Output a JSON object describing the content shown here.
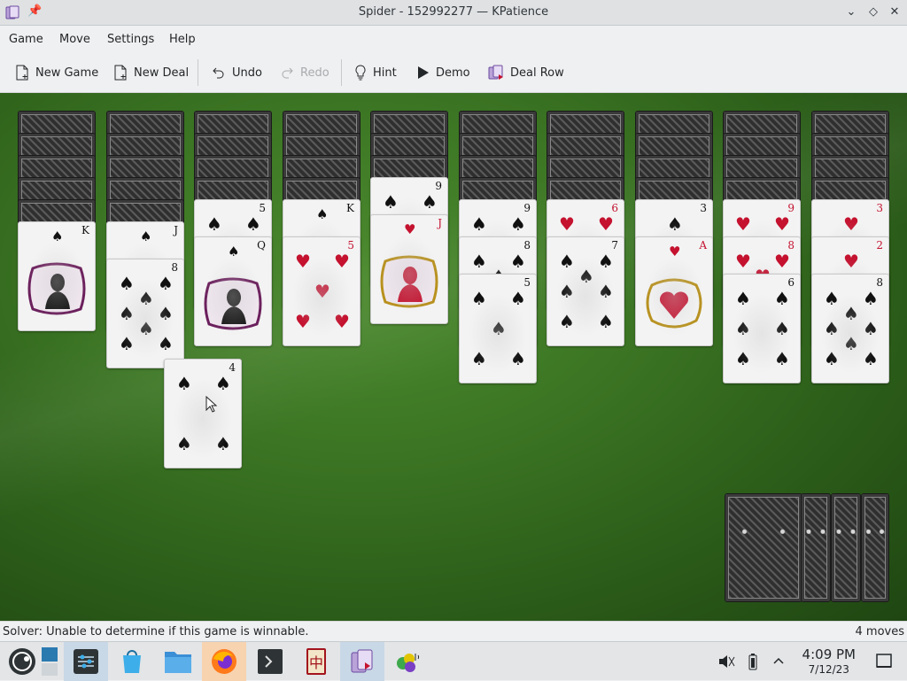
{
  "window": {
    "title": "Spider - 152992277 — KPatience",
    "pin_glyph": "📌",
    "min_glyph": "⌄",
    "max_glyph": "◇",
    "close_glyph": "✕"
  },
  "menu": [
    "Game",
    "Move",
    "Settings",
    "Help"
  ],
  "toolbar": {
    "new_game": "New Game",
    "new_deal": "New Deal",
    "undo": "Undo",
    "redo": "Redo",
    "hint": "Hint",
    "demo": "Demo",
    "deal_row": "Deal Row"
  },
  "colors": {
    "felt": "#3c7624",
    "red_suit": "#c4122f",
    "card_face": "#f3f3f3",
    "card_back": "#2f2f2f"
  },
  "tableau": {
    "columns": [
      {
        "hidden": 5,
        "cards": [
          {
            "rank": "K",
            "suit": "♠",
            "face": true
          }
        ]
      },
      {
        "hidden": 5,
        "cards": [
          {
            "rank": "J",
            "suit": "♠",
            "face": true
          },
          {
            "rank": "8",
            "suit": "♠"
          }
        ]
      },
      {
        "hidden": 4,
        "cards": [
          {
            "rank": "5",
            "suit": "♠"
          },
          {
            "rank": "Q",
            "suit": "♠",
            "face": true
          }
        ]
      },
      {
        "hidden": 4,
        "cards": [
          {
            "rank": "K",
            "suit": "♠",
            "face": true
          },
          {
            "rank": "5",
            "suit": "♥"
          }
        ]
      },
      {
        "hidden": 3,
        "cards": [
          {
            "rank": "9",
            "suit": "♠"
          },
          {
            "rank": "J",
            "suit": "♥",
            "face": true
          }
        ]
      },
      {
        "hidden": 4,
        "cards": [
          {
            "rank": "9",
            "suit": "♠"
          },
          {
            "rank": "8",
            "suit": "♠"
          },
          {
            "rank": "5",
            "suit": "♠"
          }
        ]
      },
      {
        "hidden": 4,
        "cards": [
          {
            "rank": "6",
            "suit": "♥"
          },
          {
            "rank": "7",
            "suit": "♠"
          }
        ]
      },
      {
        "hidden": 4,
        "cards": [
          {
            "rank": "3",
            "suit": "♠"
          },
          {
            "rank": "A",
            "suit": "♥",
            "face": true
          }
        ]
      },
      {
        "hidden": 4,
        "cards": [
          {
            "rank": "9",
            "suit": "♥"
          },
          {
            "rank": "8",
            "suit": "♥"
          },
          {
            "rank": "6",
            "suit": "♠"
          }
        ]
      },
      {
        "hidden": 4,
        "cards": [
          {
            "rank": "3",
            "suit": "♥"
          },
          {
            "rank": "2",
            "suit": "♥"
          },
          {
            "rank": "8",
            "suit": "♠"
          }
        ]
      }
    ],
    "dragged_card": {
      "rank": "4",
      "suit": "♠"
    }
  },
  "stock": {
    "piles": 4
  },
  "status": {
    "solver": "Solver: Unable to determine if this game is winnable.",
    "moves": "4 moves"
  },
  "taskbar": {
    "time": "4:09 PM",
    "date": "7/12/23",
    "icons": [
      "start-menu-icon",
      "desktop-pager-icon",
      "system-settings-icon",
      "discover-icon",
      "file-manager-icon",
      "firefox-icon",
      "terminal-icon",
      "mahjongg-icon",
      "kpatience-icon",
      "kdiamond-icon"
    ]
  }
}
